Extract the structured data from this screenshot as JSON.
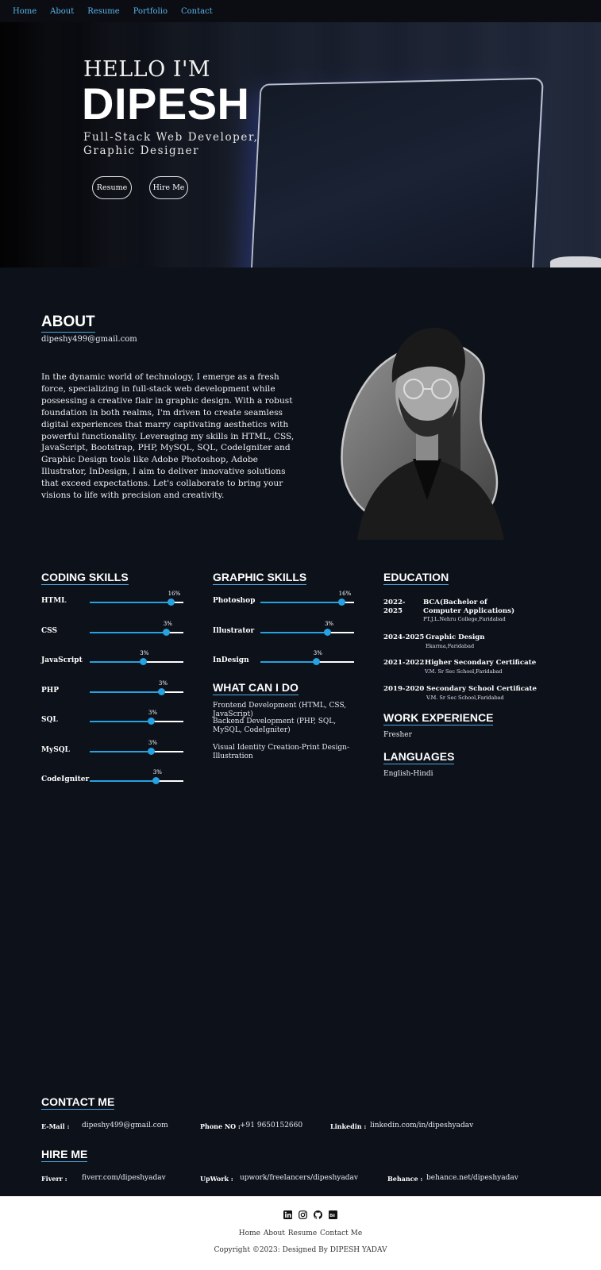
{
  "nav": {
    "items": [
      "Home",
      "About",
      "Resume",
      "Portfolio",
      "Contact"
    ]
  },
  "hero": {
    "greeting": "HELLO I'M",
    "name": "DIPESH",
    "role": "Full-Stack Web Developer, Graphic Designer",
    "buttons": {
      "resume": "Resume",
      "hire": "Hire Me"
    }
  },
  "about": {
    "heading": "ABOUT",
    "email": "dipeshy499@gmail.com",
    "text": "In the dynamic world of technology, I emerge as a fresh force, specializing in full-stack web development while possessing a creative flair in graphic design. With a robust foundation in both realms, I'm driven to create seamless digital experiences that marry captivating aesthetics with powerful functionality. Leveraging my skills in HTML, CSS, JavaScript, Bootstrap, PHP, MySQL, SQL, CodeIgniter and Graphic Design tools like Adobe Photoshop, Adobe Illustrator, InDesign, I aim to deliver innovative solutions that exceed expectations. Let's collaborate to bring your visions to life with precision and creativity."
  },
  "coding_skills": {
    "heading": "CODING SKILLS",
    "items": [
      {
        "label": "HTML",
        "pct_label": "16%",
        "level": 0.87
      },
      {
        "label": "CSS",
        "pct_label": "3%",
        "level": 0.82
      },
      {
        "label": "JavaScript",
        "pct_label": "3%",
        "level": 0.57
      },
      {
        "label": "PHP",
        "pct_label": "3%",
        "level": 0.77
      },
      {
        "label": "SQL",
        "pct_label": "3%",
        "level": 0.66
      },
      {
        "label": "MySQL",
        "pct_label": "3%",
        "level": 0.66
      },
      {
        "label": "CodeIgniter",
        "pct_label": "3%",
        "level": 0.71
      }
    ]
  },
  "graphic_skills": {
    "heading": "GRAPHIC SKILLS",
    "items": [
      {
        "label": "Photoshop",
        "pct_label": "16%",
        "level": 0.87
      },
      {
        "label": "Illustrator",
        "pct_label": "3%",
        "level": 0.72
      },
      {
        "label": "InDesign",
        "pct_label": "3%",
        "level": 0.6
      }
    ]
  },
  "what_can_i_do": {
    "heading": "WHAT CAN I DO",
    "items": [
      "Frontend Development (HTML, CSS, JavaScript)",
      "Backend Development (PHP, SQL, MySQL, CodeIgniter)",
      "Visual Identity Creation-Print Design-Illustration"
    ]
  },
  "education": {
    "heading": "EDUCATION",
    "items": [
      {
        "year": "2022-2025",
        "title": "BCA(Bachelor of Computer Applications)",
        "sub": "PT.J.L.Nehru College,Faridabad"
      },
      {
        "year": "2024-2025",
        "title": "Graphic Design",
        "sub": "Ekarma,Faridabad"
      },
      {
        "year": "2021-2022",
        "title": "Higher Secondary Certificate",
        "sub": "V.M. Sr Sec School,Faridabad"
      },
      {
        "year": "2019-2020",
        "title": "Secondary School Certificate",
        "sub": "V.M. Sr Sec School,Faridabad"
      }
    ]
  },
  "work_experience": {
    "heading": "WORK EXPERIENCE",
    "value": "Fresher"
  },
  "languages": {
    "heading": "LANGUAGES",
    "value": "English-Hindi"
  },
  "contact": {
    "heading": "CONTACT ME",
    "email_label": "E-Mail :",
    "email": "dipeshy499@gmail.com",
    "phone_label": "Phone NO :",
    "phone": "+91 9650152660",
    "linkedin_label": "Linkedin :",
    "linkedin": "linkedin.com/in/dipeshyadav"
  },
  "hire": {
    "heading": "HIRE ME",
    "fiverr_label": "Fiverr :",
    "fiverr": "fiverr.com/dipeshyadav",
    "upwork_label": "UpWork :",
    "upwork": "upwork/freelancers/dipeshyadav",
    "behance_label": "Behance :",
    "behance": "behance.net/dipeshyadav"
  },
  "footer": {
    "icons": [
      "linkedin-icon",
      "instagram-icon",
      "github-icon",
      "behance-icon"
    ],
    "links": [
      "Home",
      "About",
      "Resume",
      "Contact Me"
    ],
    "copyright": "Copyright ©2023: Designed By DIPESH YADAV"
  },
  "colors": {
    "accent": "#27a2e0",
    "background": "#0d111a",
    "nav_link": "#5ab4ea"
  }
}
